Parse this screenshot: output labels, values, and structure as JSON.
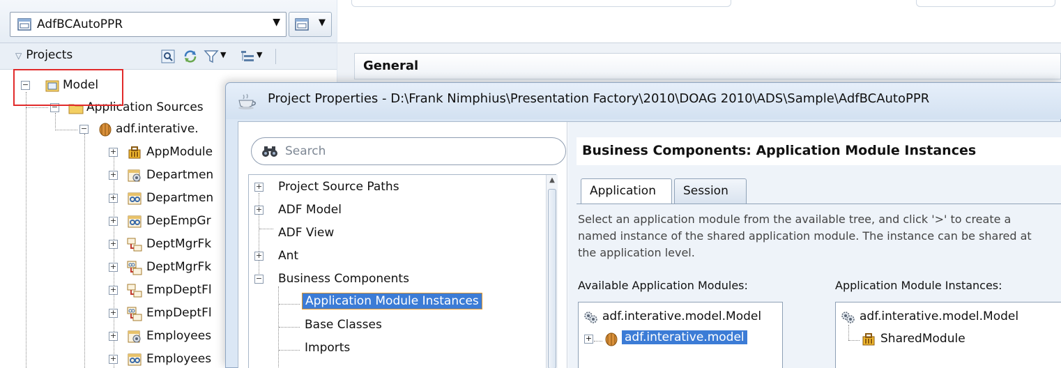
{
  "app_navigator": {
    "application_name": "AdfBCAutoPPR",
    "projects_label": "Projects",
    "tree": [
      {
        "label": "Model",
        "icon": "project-folder-icon",
        "expander": "−"
      },
      {
        "label": "Application Sources",
        "icon": "folder-icon",
        "expander": "−"
      },
      {
        "label": "adf.interative.",
        "icon": "package-icon",
        "expander": "−"
      },
      {
        "label": "AppModule",
        "icon": "application-module-icon",
        "expander": "+"
      },
      {
        "label": "Departmen",
        "icon": "entity-object-icon",
        "expander": "+"
      },
      {
        "label": "Departmen",
        "icon": "view-object-icon",
        "expander": "+"
      },
      {
        "label": "DepEmpGr",
        "icon": "view-object-icon",
        "expander": "+"
      },
      {
        "label": "DeptMgrFk",
        "icon": "association-icon",
        "expander": "+"
      },
      {
        "label": "DeptMgrFk",
        "icon": "view-link-icon",
        "expander": "+"
      },
      {
        "label": "EmpDeptFl",
        "icon": "association-icon",
        "expander": "+"
      },
      {
        "label": "EmpDeptFl",
        "icon": "view-link-icon",
        "expander": "+"
      },
      {
        "label": "Employees",
        "icon": "entity-object-icon",
        "expander": "+"
      },
      {
        "label": "Employees",
        "icon": "view-object-icon",
        "expander": "+"
      }
    ]
  },
  "editor": {
    "section_header": "General"
  },
  "dialog": {
    "title": "Project Properties - D:\\Frank Nimphius\\Presentation Factory\\2010\\DOAG 2010\\ADS\\Sample\\AdfBCAutoPPR",
    "search_placeholder": "Search",
    "nav_items": [
      {
        "label": "Project Source Paths",
        "expander": "+",
        "level": 0
      },
      {
        "label": "ADF Model",
        "expander": "+",
        "level": 0
      },
      {
        "label": "ADF View",
        "expander": "",
        "level": 0
      },
      {
        "label": "Ant",
        "expander": "+",
        "level": 0
      },
      {
        "label": "Business Components",
        "expander": "−",
        "level": 0
      },
      {
        "label": "Application Module Instances",
        "expander": "",
        "level": 1,
        "selected": true
      },
      {
        "label": "Base Classes",
        "expander": "",
        "level": 1
      },
      {
        "label": "Imports",
        "expander": "",
        "level": 1
      }
    ],
    "content": {
      "heading": "Business Components: Application Module Instances",
      "tabs": [
        "Application",
        "Session"
      ],
      "active_tab": "Application",
      "description_lines": [
        "Select an application module from the available tree, and click '>' to create a",
        "named instance of the shared application module. The instance can be shared at",
        "the application level."
      ],
      "available_label": "Available Application Modules:",
      "instances_label": "Application Module Instances:",
      "available_items": [
        {
          "label": "adf.interative.model.Model",
          "icon": "gear-group-icon"
        },
        {
          "label": "adf.interative.model",
          "icon": "package-icon",
          "selected": true
        }
      ],
      "instance_items": [
        {
          "label": "adf.interative.model.Model",
          "icon": "gear-group-icon"
        },
        {
          "label": "SharedModule",
          "icon": "application-module-icon"
        }
      ]
    }
  },
  "colors": {
    "selection": "#3c7cd6",
    "highlight_border": "#e12a2a",
    "dialog_frame": "#dbe7f5"
  }
}
